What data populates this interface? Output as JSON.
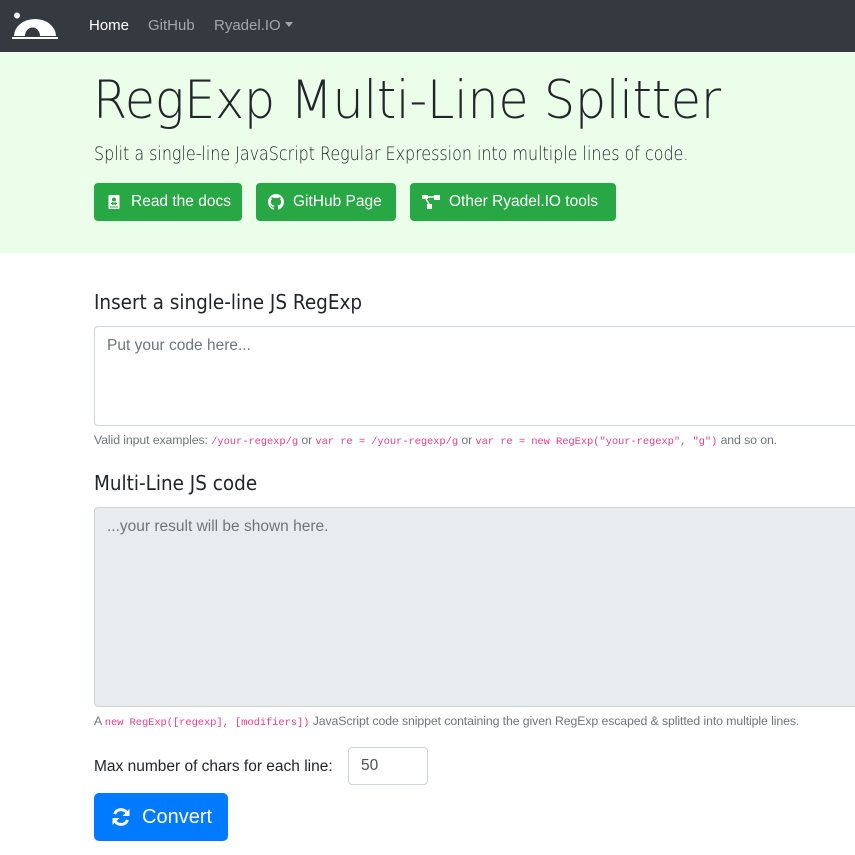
{
  "navbar": {
    "brand_icon": "ryadel-logo-icon",
    "links": [
      {
        "label": "Home",
        "active": true
      },
      {
        "label": "GitHub",
        "active": false
      },
      {
        "label": "Ryadel.IO",
        "active": false,
        "dropdown": true
      }
    ]
  },
  "jumbotron": {
    "title": "RegExp Multi-Line Splitter",
    "lead": "Split a single-line JavaScript Regular Expression into multiple lines of code.",
    "buttons": [
      {
        "label": "Read the docs",
        "icon": "book-icon"
      },
      {
        "label": "GitHub Page",
        "icon": "github-icon"
      },
      {
        "label": "Other Ryadel.IO tools",
        "icon": "sitemap-icon"
      }
    ]
  },
  "input_section": {
    "heading": "Insert a single-line JS RegExp",
    "placeholder": "Put your code here...",
    "value": "",
    "help": {
      "prefix": "Valid input examples: ",
      "ex1": "/your-regexp/g",
      "or1": " or ",
      "ex2": "var re = /your-regexp/g",
      "or2": " or ",
      "ex3": "var re = new RegExp(\"your-regexp\", \"g\")",
      "suffix": " and so on."
    }
  },
  "output_section": {
    "heading": "Multi-Line JS code",
    "placeholder": "...your result will be shown here.",
    "value": "",
    "help": {
      "prefix": "A ",
      "code": "new RegExp([regexp], [modifiers])",
      "suffix": " JavaScript code snippet containing the given RegExp escaped & splitted into multiple lines."
    }
  },
  "options": {
    "max_chars_label": "Max number of chars for each line:",
    "max_chars_value": "50"
  },
  "convert_button": {
    "label": "Convert",
    "icon": "sync-icon"
  },
  "colors": {
    "navbar_bg": "#343a40",
    "jumbotron_bg": "#eafeea",
    "success": "#28a745",
    "primary": "#007bff",
    "code": "#e83e8c",
    "readonly_bg": "#e9ecef"
  }
}
